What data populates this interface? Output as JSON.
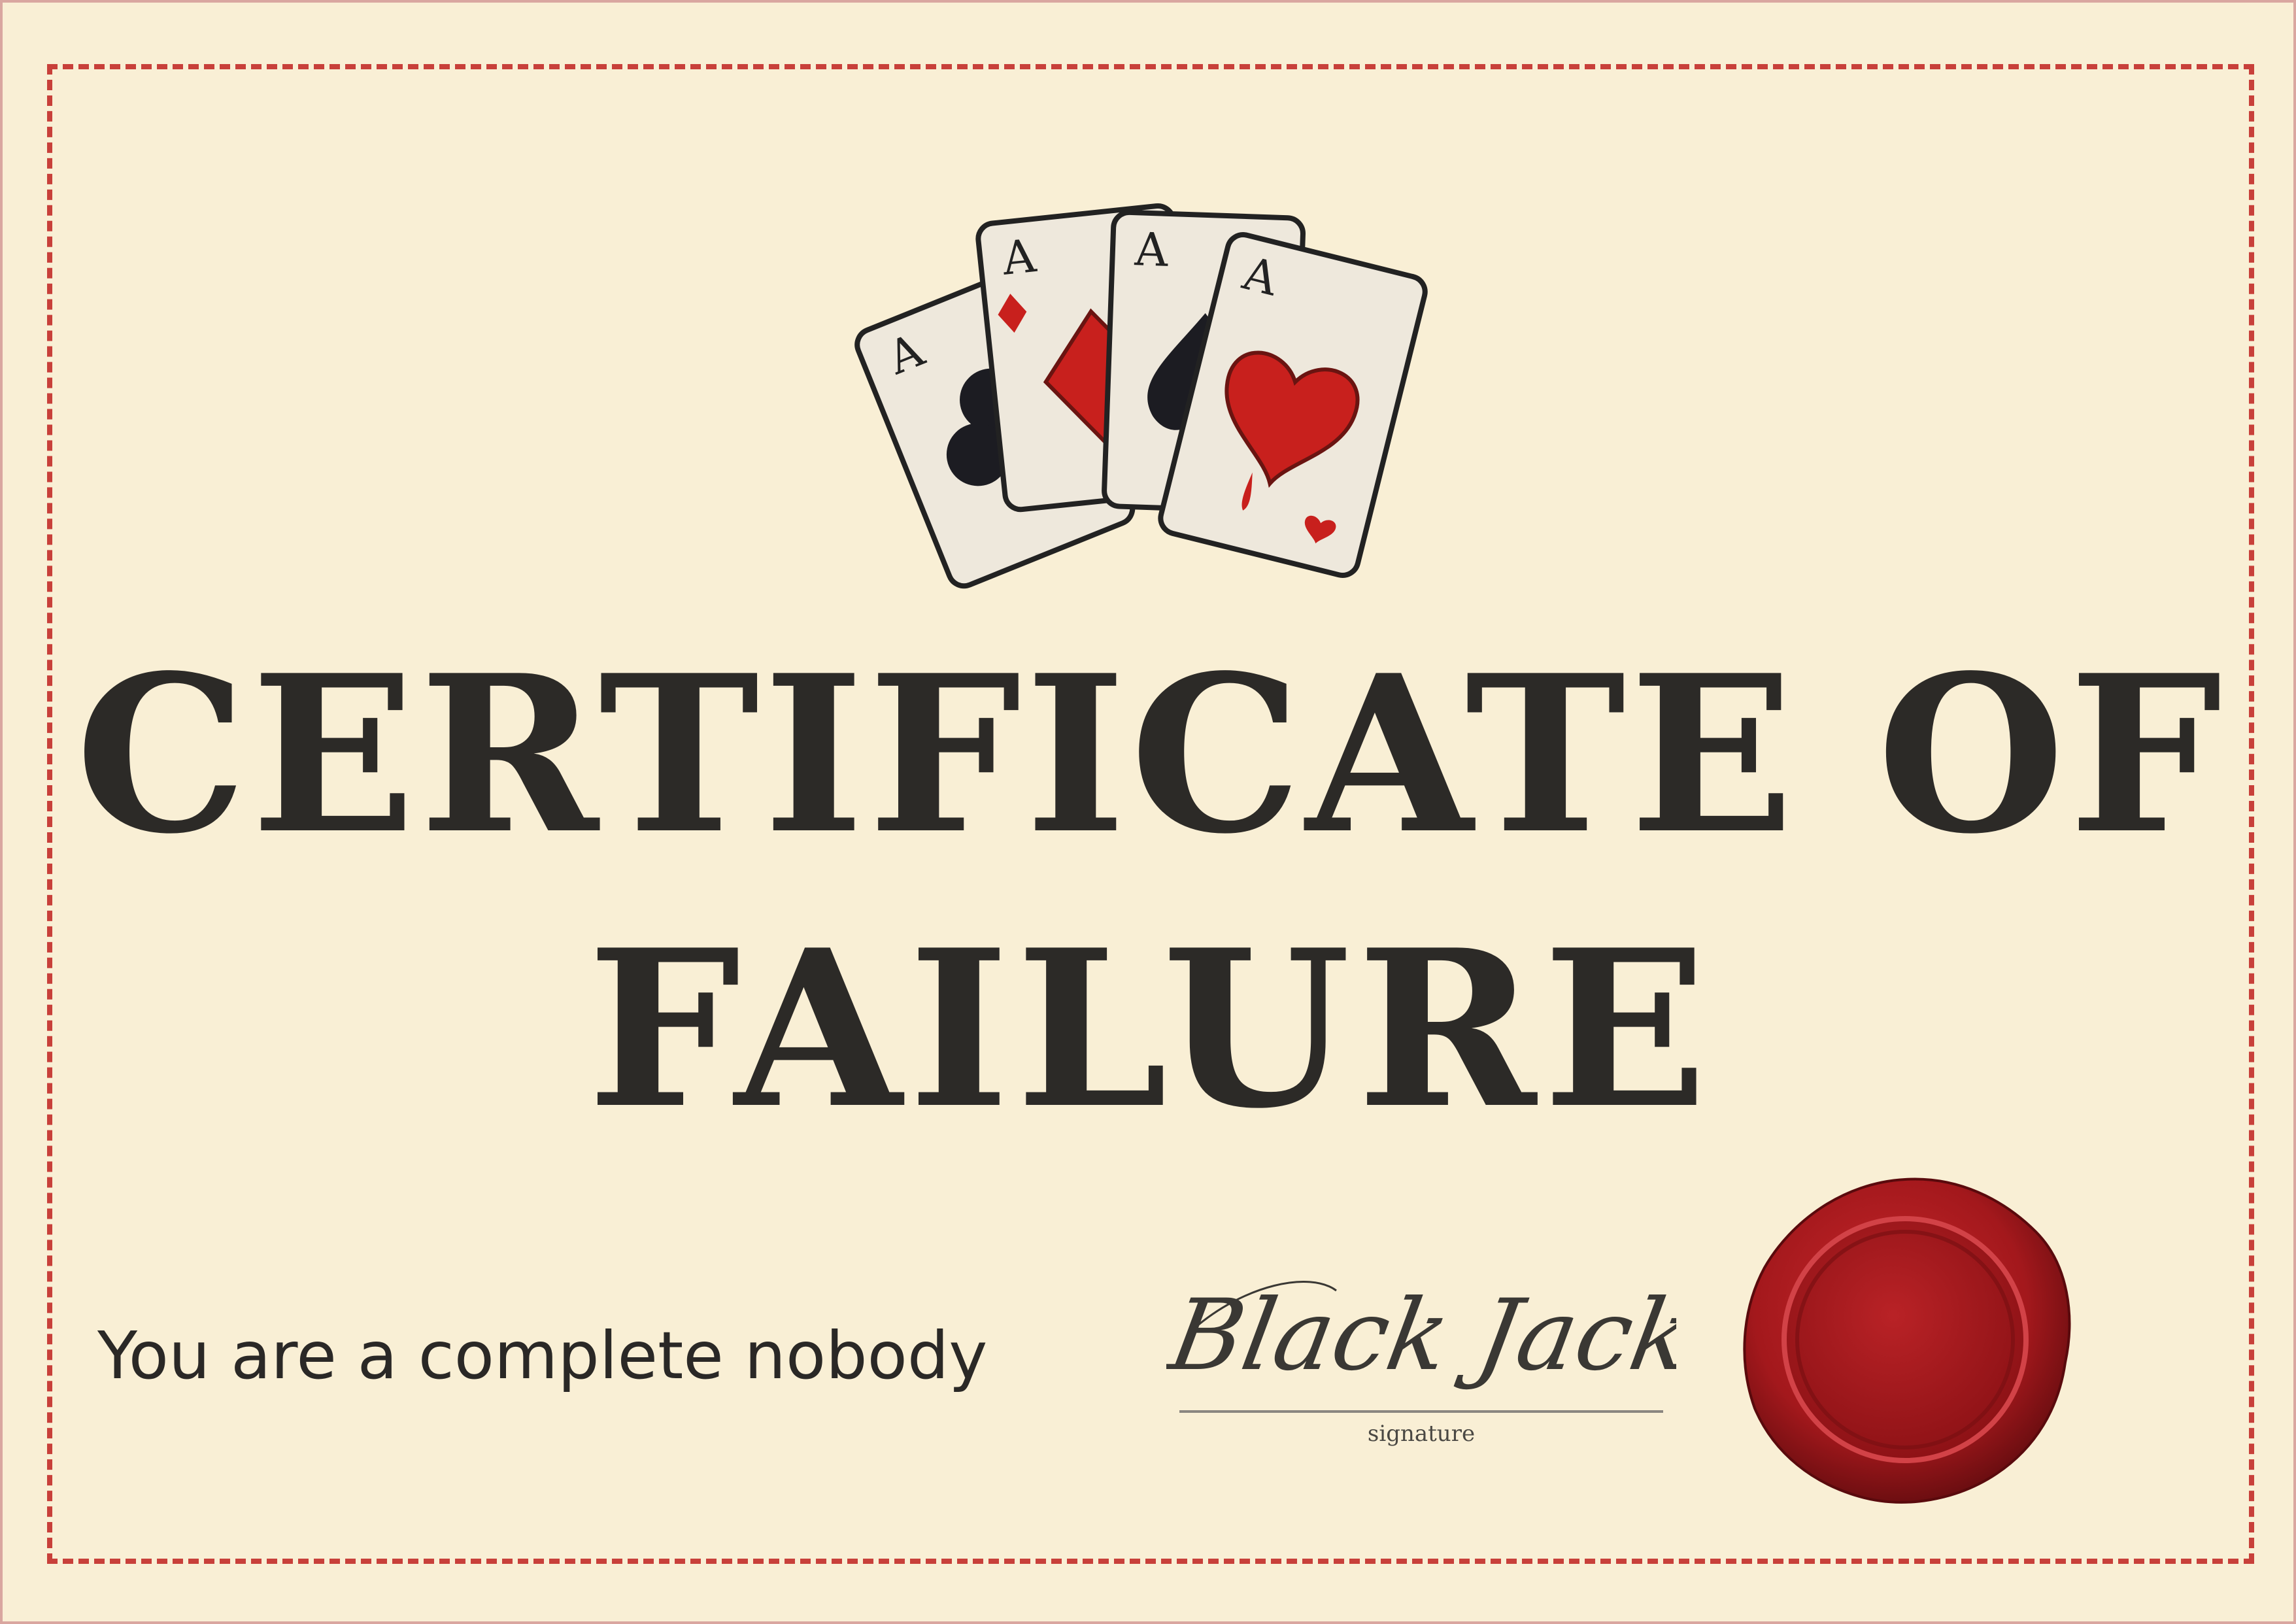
{
  "certificate": {
    "title_line_1": "CERTIFICATE OF",
    "title_line_2": "FAILURE",
    "message": "You are a complete nobody"
  },
  "signature": {
    "name": "Black Jack",
    "caption": "signature"
  },
  "cards": {
    "rank_label": "A",
    "suits": [
      "club",
      "diamond",
      "spade",
      "heart"
    ]
  },
  "colors": {
    "background": "#f9efd5",
    "border_dash": "#c8403a",
    "title_text": "#2c2a27",
    "seal_red": "#a3181c",
    "card_red": "#c8201d"
  }
}
